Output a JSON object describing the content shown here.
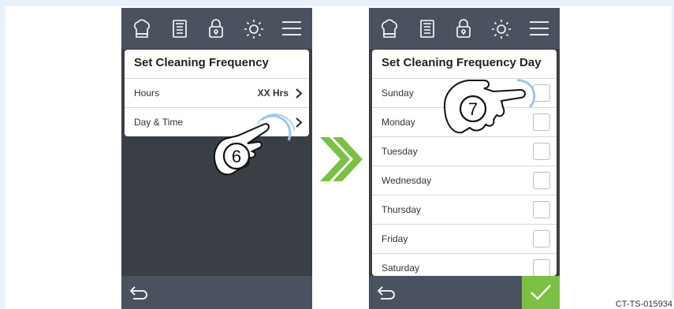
{
  "left_screen": {
    "title": "Set Cleaning Frequency",
    "rows": [
      {
        "label": "Hours",
        "value": "XX Hrs"
      },
      {
        "label": "Day & Time",
        "value": ""
      }
    ],
    "step": "6"
  },
  "right_screen": {
    "title": "Set Cleaning Frequency Day",
    "days": [
      "Sunday",
      "Monday",
      "Tuesday",
      "Wednesday",
      "Thursday",
      "Friday",
      "Saturday"
    ],
    "step": "7"
  },
  "toolbar_icons": [
    "chef-hat-icon",
    "recipe-book-icon",
    "lock-icon",
    "brightness-icon",
    "menu-icon"
  ],
  "colors": {
    "accent_green": "#7cc043",
    "bar": "#4a5260",
    "panel": "#3a3f46"
  },
  "reference_code": "CT-TS-015934"
}
